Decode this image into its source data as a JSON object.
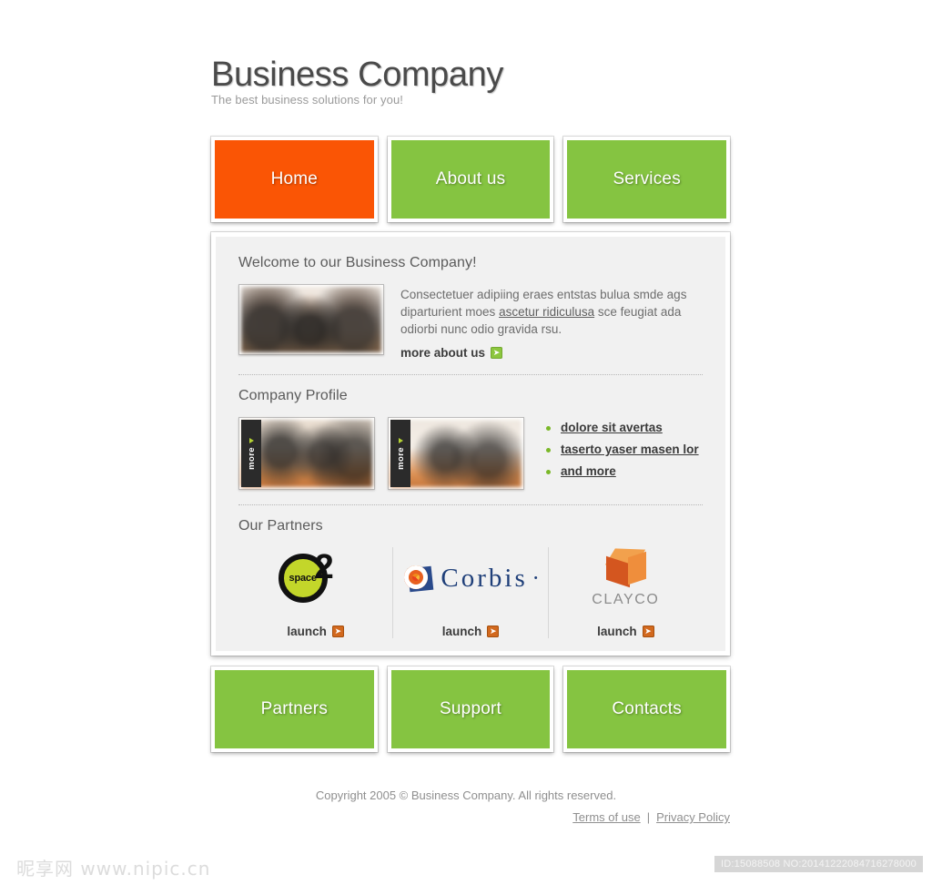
{
  "header": {
    "title": "Business Company",
    "tagline": "The best business solutions for you!"
  },
  "nav_top": [
    {
      "label": "Home",
      "active": true
    },
    {
      "label": "About us",
      "active": false
    },
    {
      "label": "Services",
      "active": false
    }
  ],
  "nav_bottom": [
    {
      "label": "Partners"
    },
    {
      "label": "Support"
    },
    {
      "label": "Contacts"
    }
  ],
  "welcome": {
    "heading": "Welcome to our Business Company!",
    "text_before": "Consectetuer adipiing eraes entstas bulua smde ags diparturient moes ",
    "inline_link": "ascetur ridiculusa",
    "text_after": " sce feugiat ada odiorbi nunc odio gravida rsu.",
    "more_label": "more about us",
    "arrow_icon": "arrow-right-icon"
  },
  "profile": {
    "heading": "Company Profile",
    "thumb_tab_label": "more",
    "links": [
      "dolore sit avertas",
      "taserto yaser masen lor",
      "and more"
    ]
  },
  "partners": {
    "heading": "Our Partners",
    "launch_label": "launch",
    "items": [
      {
        "name": "space2",
        "logo_text": "space",
        "logo_suffix": "2",
        "launch": "launch"
      },
      {
        "name": "Corbis",
        "logo_text": "Corbis",
        "logo_suffix": "•",
        "launch": "launch"
      },
      {
        "name": "CLAYCO",
        "logo_text": "CLAYCO",
        "logo_suffix": "",
        "launch": "launch"
      }
    ]
  },
  "footer": {
    "copyright": "Copyright 2005 © Business Company. All rights reserved.",
    "terms": "Terms of use",
    "separator": "|",
    "privacy": "Privacy Policy"
  },
  "watermark": {
    "left": "昵享网 www.nipic.cn",
    "right": "ID:15088508 NO:20141222084716278000"
  },
  "colors": {
    "nav_green": "#85c441",
    "nav_active_orange": "#fa5505",
    "panel_bg": "#f1f1f1",
    "arrow_green": "#8cc63e",
    "arrow_orange": "#d2691e",
    "bullet_green": "#7ab828"
  }
}
